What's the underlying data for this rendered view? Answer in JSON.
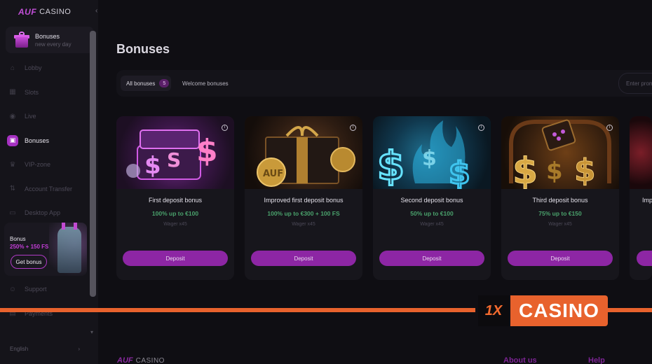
{
  "logo": {
    "mark": "AUF",
    "text": "CASINO"
  },
  "promo": {
    "title": "Bonuses",
    "subtitle": "new every day"
  },
  "nav": {
    "items": [
      {
        "label": "Lobby",
        "icon": "home-icon"
      },
      {
        "label": "Slots",
        "icon": "slots-icon"
      },
      {
        "label": "Live",
        "icon": "live-icon"
      },
      {
        "label": "Bonuses",
        "icon": "gift-icon",
        "active": true
      },
      {
        "label": "VIP-zone",
        "icon": "crown-icon"
      },
      {
        "label": "Account Transfer",
        "icon": "transfer-icon"
      },
      {
        "label": "Desktop App",
        "icon": "desktop-icon"
      }
    ],
    "bottom_items": [
      {
        "label": "Support",
        "icon": "support-icon"
      },
      {
        "label": "Payments",
        "icon": "payments-icon"
      }
    ]
  },
  "sidebar_banner": {
    "title": "Bonus",
    "offer": "250% + 150 FS",
    "button": "Get bonus"
  },
  "language": {
    "label": "English"
  },
  "page": {
    "title": "Bonuses"
  },
  "tabs": [
    {
      "label": "All bonuses",
      "count": "5"
    },
    {
      "label": "Welcome bonuses"
    }
  ],
  "search": {
    "placeholder": "Enter promo code"
  },
  "cards": [
    {
      "title": "First deposit bonus",
      "offer": "100% up to €100",
      "wager": "Wager x45",
      "button": "Deposit"
    },
    {
      "title": "Improved first deposit bonus",
      "offer": "100% up to €300 + 100 FS",
      "wager": "Wager x45",
      "button": "Deposit"
    },
    {
      "title": "Second deposit bonus",
      "offer": "50% up to €100",
      "wager": "Wager x45",
      "button": "Deposit"
    },
    {
      "title": "Third deposit bonus",
      "offer": "75% up to €150",
      "wager": "Wager x45",
      "button": "Deposit"
    },
    {
      "title": "Imp",
      "offer": "",
      "wager": "",
      "button": ""
    }
  ],
  "footer": {
    "logo_mark": "AUF",
    "logo_text": "CASINO",
    "links": [
      "About us",
      "Help"
    ]
  },
  "watermark": {
    "mark": "1X",
    "label": "CASINO"
  },
  "colors": {
    "accent": "#a631c2",
    "offer_green": "#4aa26c",
    "watermark_orange": "#e8622d"
  }
}
